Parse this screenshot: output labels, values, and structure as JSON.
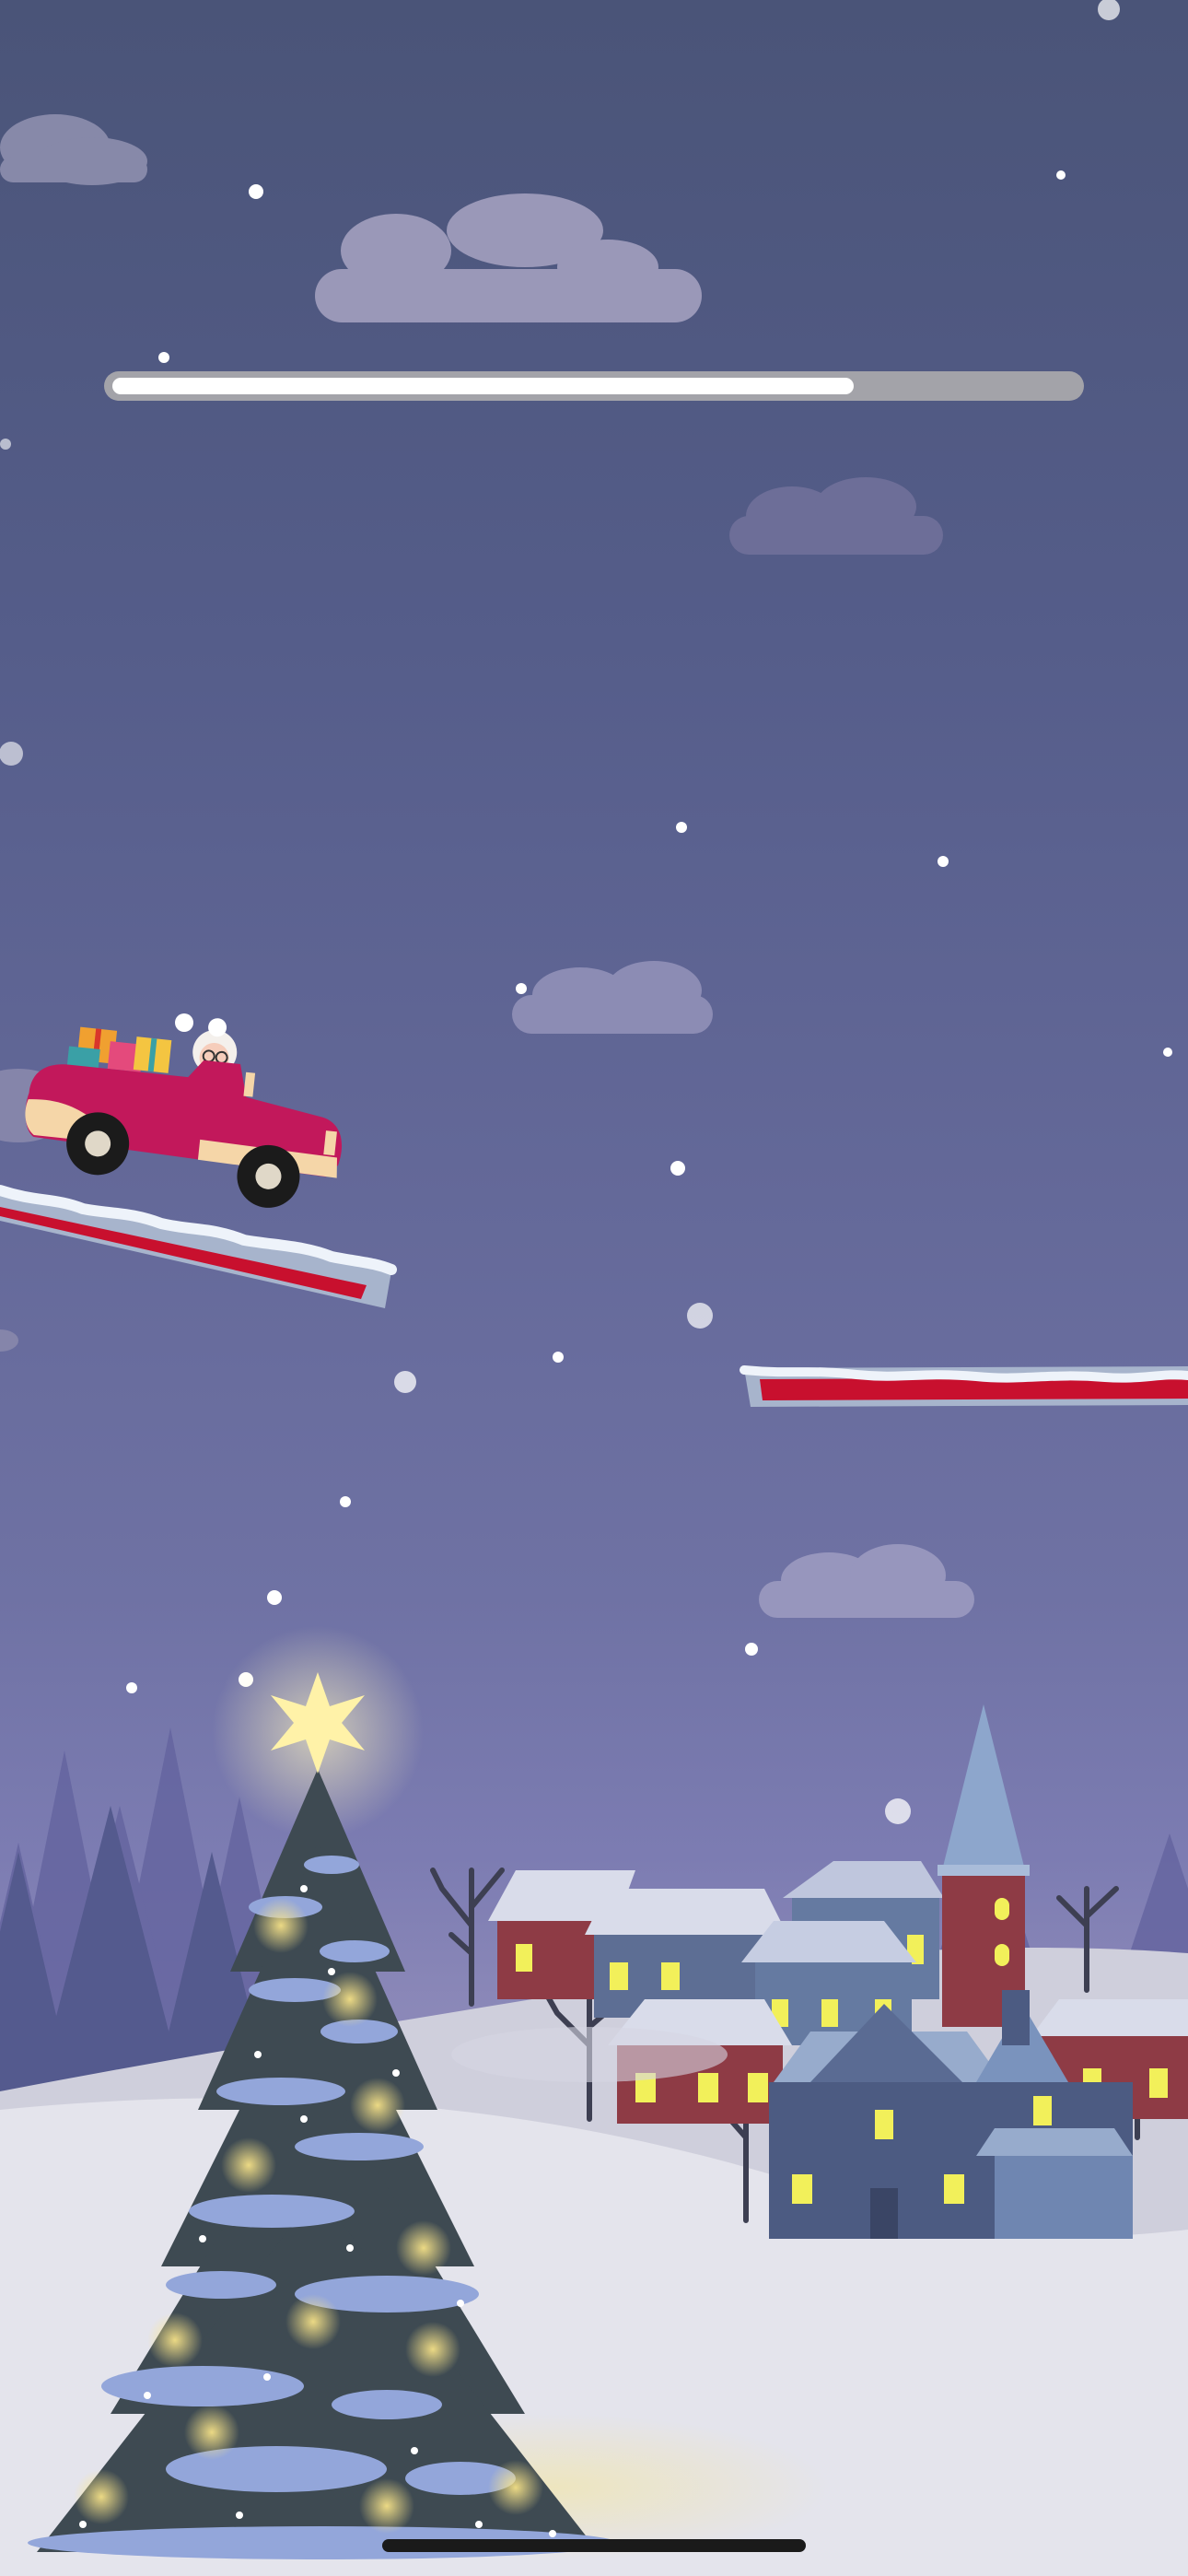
{
  "game": {
    "level_progress": 0.77,
    "colors": {
      "sky_top": "#4a5478",
      "sky_bottom": "#8b88b8",
      "snow": "#e4e4ec",
      "car_body": "#c2185b",
      "car_trim": "#f5d6a8",
      "ramp_red": "#c8102e",
      "progress_fill": "#ffffff",
      "progress_track": "#a3a3a9",
      "tree_star": "#fff2a8"
    },
    "icons": {
      "player_vehicle": "santa-truck-icon",
      "tree_star": "star-icon"
    }
  }
}
